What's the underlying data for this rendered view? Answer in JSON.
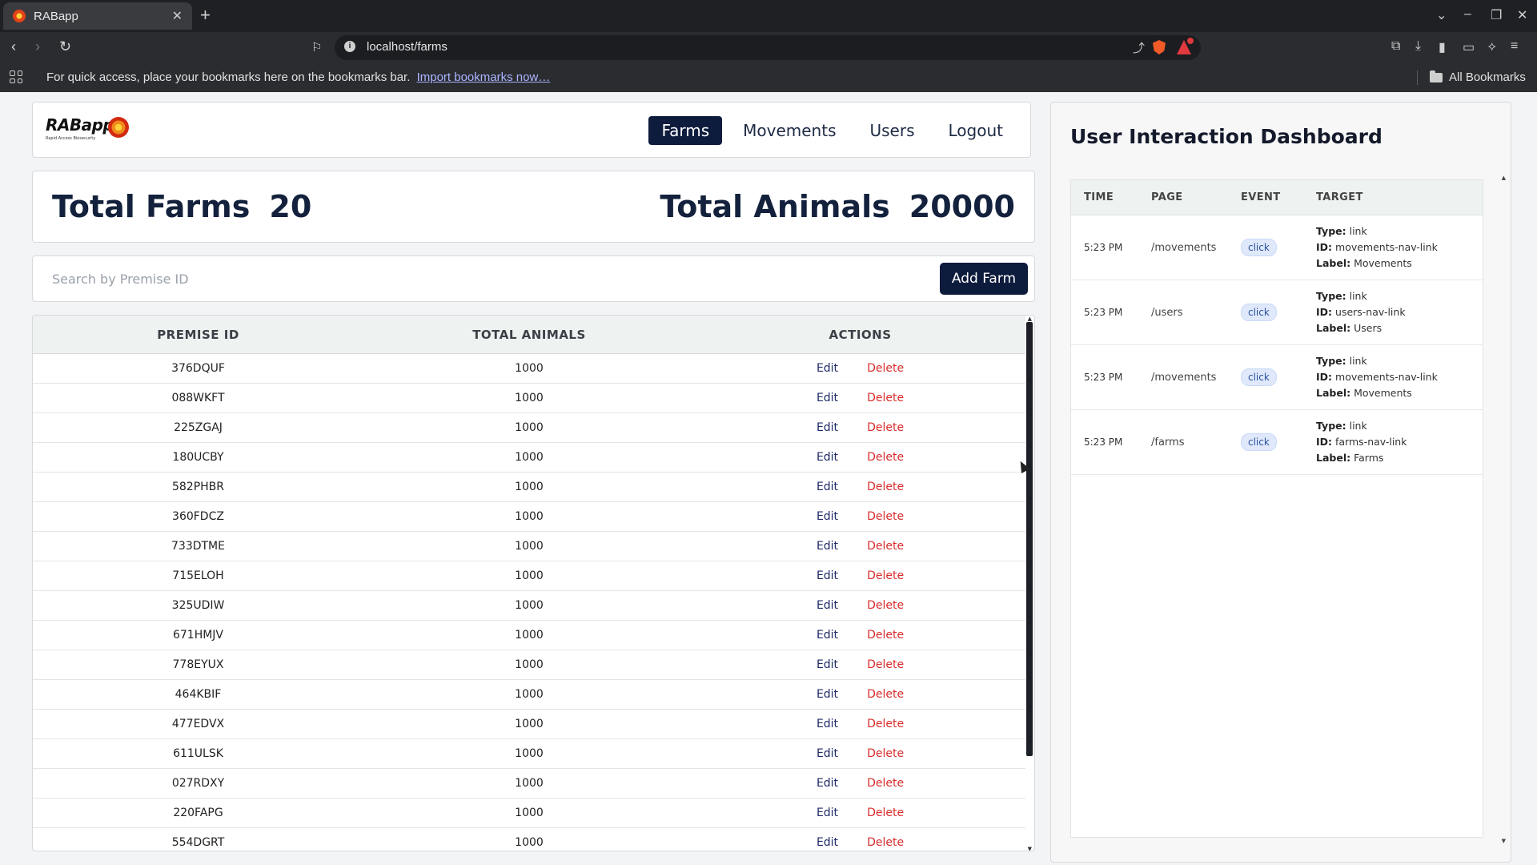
{
  "browser": {
    "tab_title": "RABapp",
    "url": "localhost/farms",
    "bookmarks_message": "For quick access, place your bookmarks here on the bookmarks bar.",
    "bookmarks_link": "Import bookmarks now…",
    "all_bookmarks": "All Bookmarks"
  },
  "app": {
    "logo_text": "RABapp",
    "logo_sub": "Rapid Access Biosecurity",
    "nav": [
      {
        "label": "Farms",
        "active": true
      },
      {
        "label": "Movements",
        "active": false
      },
      {
        "label": "Users",
        "active": false
      },
      {
        "label": "Logout",
        "active": false
      }
    ]
  },
  "stats": {
    "farms_label": "Total Farms",
    "farms_value": "20",
    "animals_label": "Total Animals",
    "animals_value": "20000"
  },
  "search": {
    "placeholder": "Search by Premise ID",
    "add_button": "Add Farm"
  },
  "farms_table": {
    "headers": [
      "PREMISE ID",
      "TOTAL ANIMALS",
      "ACTIONS"
    ],
    "edit_label": "Edit",
    "delete_label": "Delete",
    "rows": [
      {
        "premise_id": "376DQUF",
        "total_animals": "1000"
      },
      {
        "premise_id": "088WKFT",
        "total_animals": "1000"
      },
      {
        "premise_id": "225ZGAJ",
        "total_animals": "1000"
      },
      {
        "premise_id": "180UCBY",
        "total_animals": "1000"
      },
      {
        "premise_id": "582PHBR",
        "total_animals": "1000"
      },
      {
        "premise_id": "360FDCZ",
        "total_animals": "1000"
      },
      {
        "premise_id": "733DTME",
        "total_animals": "1000"
      },
      {
        "premise_id": "715ELOH",
        "total_animals": "1000"
      },
      {
        "premise_id": "325UDIW",
        "total_animals": "1000"
      },
      {
        "premise_id": "671HMJV",
        "total_animals": "1000"
      },
      {
        "premise_id": "778EYUX",
        "total_animals": "1000"
      },
      {
        "premise_id": "464KBIF",
        "total_animals": "1000"
      },
      {
        "premise_id": "477EDVX",
        "total_animals": "1000"
      },
      {
        "premise_id": "611ULSK",
        "total_animals": "1000"
      },
      {
        "premise_id": "027RDXY",
        "total_animals": "1000"
      },
      {
        "premise_id": "220FAPG",
        "total_animals": "1000"
      },
      {
        "premise_id": "554DGRT",
        "total_animals": "1000"
      }
    ]
  },
  "dashboard": {
    "title": "User Interaction Dashboard",
    "headers": [
      "TIME",
      "PAGE",
      "EVENT",
      "TARGET"
    ],
    "type_label": "Type:",
    "id_label": "ID:",
    "label_label": "Label:",
    "rows": [
      {
        "time": "5:23 PM",
        "page": "/movements",
        "event": "click",
        "type": "link",
        "id": "movements-nav-link",
        "label": "Movements"
      },
      {
        "time": "5:23 PM",
        "page": "/users",
        "event": "click",
        "type": "link",
        "id": "users-nav-link",
        "label": "Users"
      },
      {
        "time": "5:23 PM",
        "page": "/movements",
        "event": "click",
        "type": "link",
        "id": "movements-nav-link",
        "label": "Movements"
      },
      {
        "time": "5:23 PM",
        "page": "/farms",
        "event": "click",
        "type": "link",
        "id": "farms-nav-link",
        "label": "Farms"
      }
    ]
  },
  "colors": {
    "primary": "#0d1b3d",
    "delete": "#d92c2c",
    "edit": "#1d2a66",
    "badge_bg": "#dfe9fb"
  }
}
